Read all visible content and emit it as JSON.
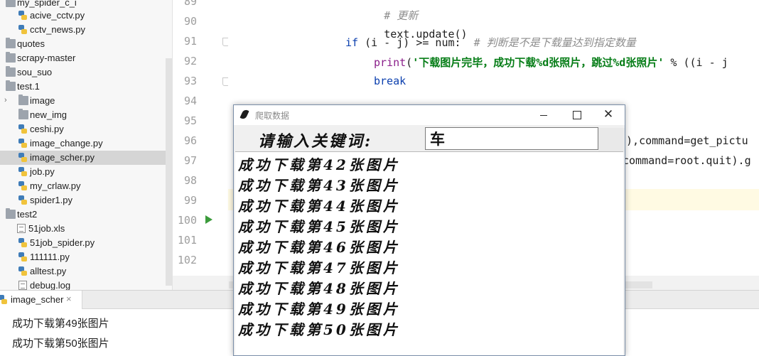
{
  "project_tree": {
    "items": [
      {
        "label": "my_spider_c_i",
        "kind": "folder",
        "indent": 1
      },
      {
        "label": "acive_cctv.py",
        "kind": "py",
        "indent": 2
      },
      {
        "label": "cctv_news.py",
        "kind": "py",
        "indent": 2
      },
      {
        "label": "quotes",
        "kind": "folder",
        "indent": 1
      },
      {
        "label": "scrapy-master",
        "kind": "folder",
        "indent": 1
      },
      {
        "label": "sou_suo",
        "kind": "folder",
        "indent": 1
      },
      {
        "label": "test.1",
        "kind": "folder",
        "indent": 1
      },
      {
        "label": "image",
        "kind": "folder",
        "indent": 2,
        "collapsed": true
      },
      {
        "label": "new_img",
        "kind": "folder",
        "indent": 2
      },
      {
        "label": "ceshi.py",
        "kind": "py",
        "indent": 2
      },
      {
        "label": "image_change.py",
        "kind": "py",
        "indent": 2
      },
      {
        "label": "image_scher.py",
        "kind": "py",
        "indent": 2,
        "selected": true
      },
      {
        "label": "job.py",
        "kind": "py",
        "indent": 2
      },
      {
        "label": "my_crlaw.py",
        "kind": "py",
        "indent": 2
      },
      {
        "label": "spider1.py",
        "kind": "py",
        "indent": 2
      },
      {
        "label": "test2",
        "kind": "folder",
        "indent": 1
      },
      {
        "label": "51job.xls",
        "kind": "file",
        "indent": 2
      },
      {
        "label": "51job_spider.py",
        "kind": "py",
        "indent": 2
      },
      {
        "label": "111111.py",
        "kind": "py",
        "indent": 2
      },
      {
        "label": "alltest.py",
        "kind": "py",
        "indent": 2
      },
      {
        "label": "debug.log",
        "kind": "file",
        "indent": 2
      }
    ]
  },
  "editor": {
    "line_numbers": [
      "89",
      "90",
      "91",
      "92",
      "93",
      "94",
      "95",
      "96",
      "97",
      "98",
      "99",
      "100",
      "101",
      "102"
    ],
    "code": {
      "l89_comment": "# 更新",
      "l90": "text.update()",
      "l91_kw": "if",
      "l91_code": " (i - j) >= num:  ",
      "l91_comment": "# 判断是不是下载量达到指定数量",
      "l92_fn": "print",
      "l92_open": "(",
      "l92_str": "'下载图片完毕，成功下载%d张照片，跳过%d张照片'",
      "l92_rest": " % ((i - j",
      "l93_kw": "break",
      "l96_peek_a": "5),",
      "l96_peek_param": "command",
      "l96_peek_b": "=get_pictu",
      "l97_peek_param": "command",
      "l97_peek_b": "=root.quit).g"
    }
  },
  "run_panel": {
    "tab_label": "image_scher",
    "close_label": "×",
    "console_lines": [
      "成功下载第49张图片",
      "成功下载第50张图片"
    ]
  },
  "tk_window": {
    "title": "爬取数据",
    "close_glyph": "✕",
    "prompt_label": "请输入关键词:",
    "keyword_value": "车",
    "log_lines": [
      "成功下载第42张图片",
      "成功下载第43张图片",
      "成功下载第44张图片",
      "成功下载第45张图片",
      "成功下载第46张图片",
      "成功下载第47张图片",
      "成功下载第48张图片",
      "成功下载第49张图片",
      "成功下载第50张图片"
    ]
  },
  "colors": {
    "keyword": "#0b3fae",
    "string": "#067d17",
    "comment": "#8c8c8c",
    "builtin": "#8a1f8a",
    "selection": "#d5d5d5",
    "current_line": "#fffae3"
  }
}
